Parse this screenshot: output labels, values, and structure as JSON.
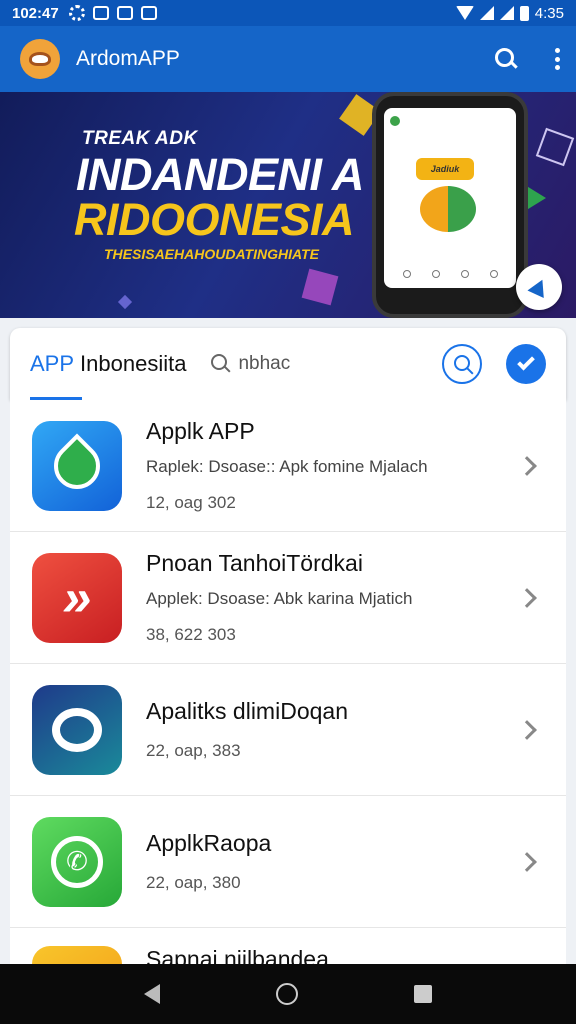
{
  "status_bar": {
    "time": "102:47",
    "battery_time": "4:35"
  },
  "app_bar": {
    "title": "ArdomAPP"
  },
  "banner": {
    "kicker": "TREAK ADK",
    "headline": "INDANDENI A",
    "headline2": "RIDOONESIA",
    "subline": "THESISAEHAHOUDATINGHIATE",
    "phone_card": "Jadiuk"
  },
  "tabs": {
    "active_accent": "APP",
    "active_label": "Inbonesiita",
    "search_label": "nbhac"
  },
  "apps": [
    {
      "title": "Applk APP",
      "desc": "Raplek: Dsoase:: Apk fomine Mjalach",
      "meta": "12, oag 302",
      "color": "blue",
      "icon": "leaf-icon"
    },
    {
      "title": "Pnoan TanhoiTördkai",
      "desc": "Applek: Dsoase: Abk karina Mjatich",
      "meta": "38, 622 303",
      "color": "red",
      "icon": "arrows-icon"
    },
    {
      "title": "Apalitks dlimiDoqan",
      "desc": "",
      "meta": "22, oap, 383",
      "color": "navy",
      "icon": "ring-icon"
    },
    {
      "title": "ApplkRaopa",
      "desc": "",
      "meta": "22, oap, 380",
      "color": "green",
      "icon": "chat-icon"
    },
    {
      "title": "Sapnai niilbandea",
      "desc": "",
      "meta": "",
      "color": "yellow",
      "icon": "app-icon"
    }
  ],
  "colors": {
    "primary": "#1565c8",
    "accent": "#1a73e8",
    "banner_yellow": "#f6c51c"
  }
}
